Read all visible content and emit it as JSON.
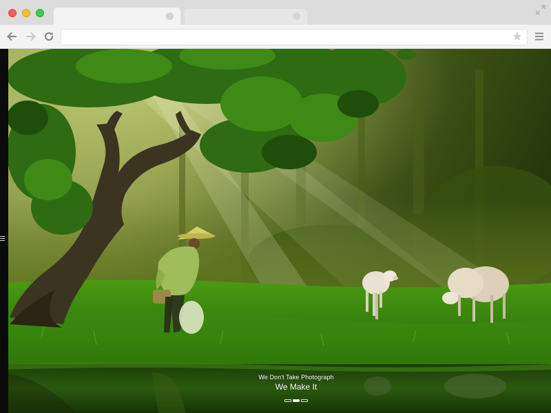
{
  "browser": {
    "tabs": [
      {
        "label": "",
        "active": true
      },
      {
        "label": "",
        "active": false
      }
    ],
    "address_bar": {
      "value": ""
    },
    "icons": {
      "back": "back-arrow-icon",
      "forward": "forward-arrow-icon",
      "reload": "reload-icon",
      "bookmark": "star-icon",
      "menu": "hamburger-menu-icon",
      "fullscreen": "expand-icon"
    }
  },
  "hero": {
    "subtitle": "We Don't Take Photograph",
    "title": "We Make It",
    "slides": [
      {
        "active": false
      },
      {
        "active": true
      },
      {
        "active": false
      }
    ]
  },
  "colors": {
    "close": "#f25f58",
    "minimize": "#f9be2f",
    "maximize": "#3ccb4a",
    "grass": "#3f8f12",
    "canopy": "#2e6b12"
  }
}
